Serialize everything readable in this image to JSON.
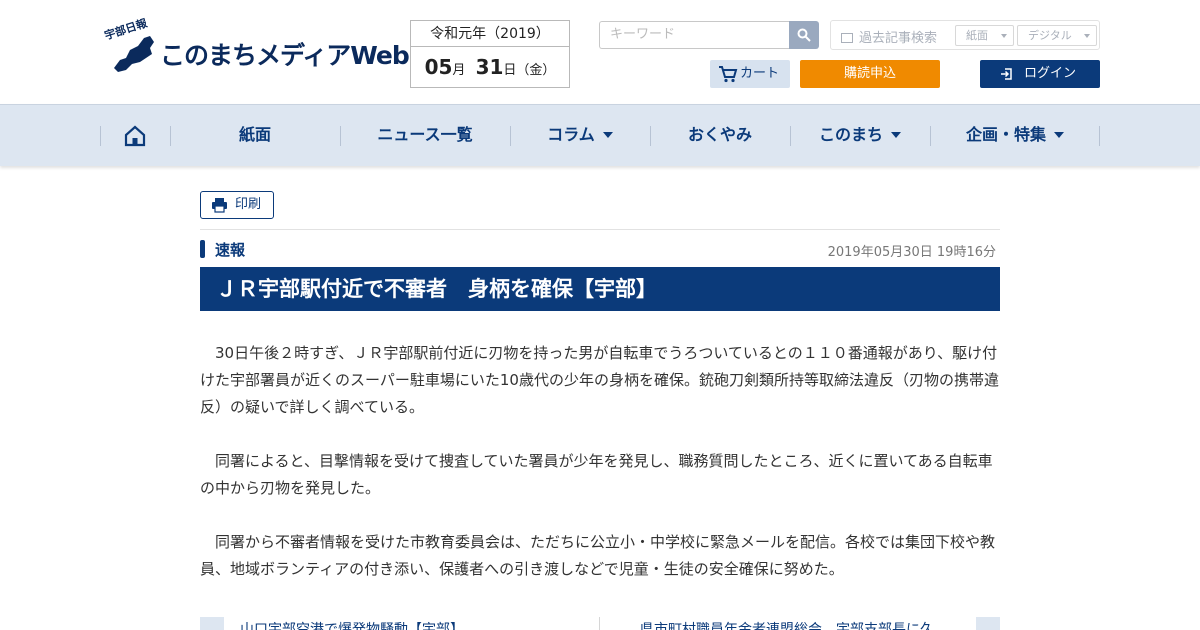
{
  "header": {
    "logo_text": "このまちメディアWeb",
    "logo_badge": "宇部日報",
    "date_era": "令和元年（2019）",
    "date_month": "05",
    "date_month_unit": "月",
    "date_day": "31",
    "date_day_unit": "日",
    "date_weekday": "（金）",
    "search_placeholder": "キーワード",
    "archive_label": "過去記事検索",
    "archive_select_1": "紙面",
    "archive_select_2": "デジタル",
    "cart_label": "カート",
    "subscribe_label": "購読申込",
    "login_label": "ログイン"
  },
  "nav": {
    "items": [
      {
        "label": "紙面"
      },
      {
        "label": "ニュース一覧"
      },
      {
        "label": "コラム"
      },
      {
        "label": "おくやみ"
      },
      {
        "label": "このまち"
      },
      {
        "label": "企画・特集"
      }
    ]
  },
  "article": {
    "print_label": "印刷",
    "category": "速報",
    "timestamp": "2019年05月30日 19時16分",
    "headline": "ＪＲ宇部駅付近で不審者　身柄を確保【宇部】",
    "paragraphs": [
      "30日午後２時すぎ、ＪＲ宇部駅前付近に刃物を持った男が自転車でうろついているとの１１０番通報があり、駆け付けた宇部署員が近くのスーパー駐車場にいた10歳代の少年の身柄を確保。銃砲刀剣類所持等取締法違反（刃物の携帯違反）の疑いで詳しく調べている。",
      "同署によると、目撃情報を受けて捜査していた署員が少年を発見し、職務質問したところ、近くに置いてある自転車の中から刃物を発見した。",
      "同署から不審者情報を受けた市教育委員会は、ただちに公立小・中学校に緊急メールを配信。各校では集団下校や教員、地域ボランティアの付き添い、保護者への引き渡しなどで児童・生徒の安全確保に努めた。"
    ]
  },
  "related": {
    "prev_title": "山口宇部空港で爆発物騒動【宇部】",
    "next_title": "県市町村職員年金者連盟総会　宇部支部長に久"
  },
  "colors": {
    "brand_navy": "#0b3a7a",
    "subscribe_orange": "#f08a00",
    "nav_background": "#dde6f1"
  }
}
